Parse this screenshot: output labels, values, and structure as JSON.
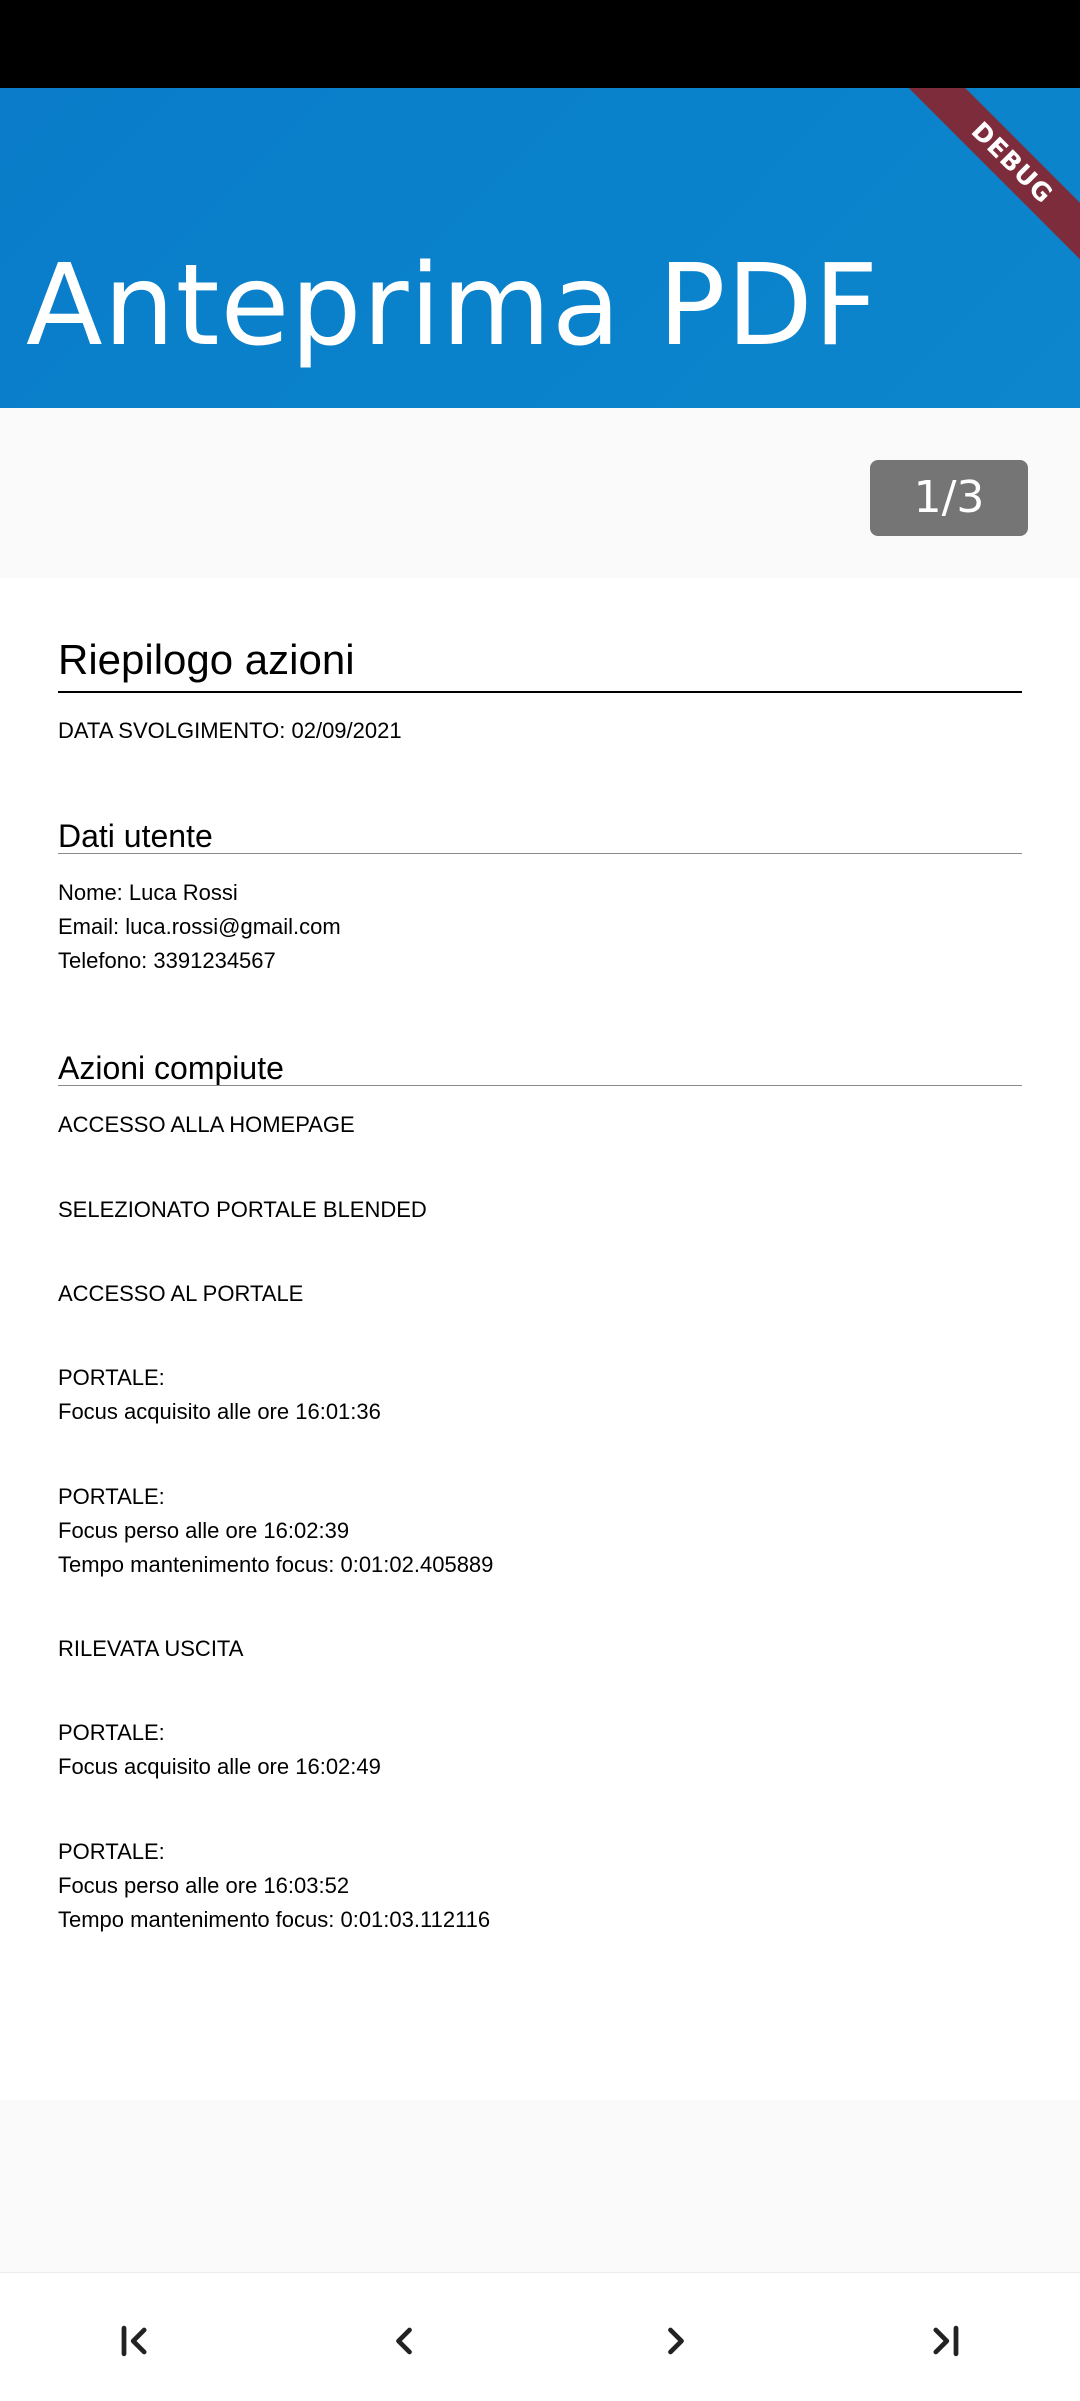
{
  "app_bar": {
    "title": "Anteprima PDF",
    "debug_label": "DEBUG"
  },
  "pager": {
    "indicator": "1/3"
  },
  "document": {
    "title": "Riepilogo azioni",
    "date_line": "DATA SVOLGIMENTO: 02/09/2021",
    "user_section": {
      "heading": "Dati utente",
      "name": "Nome: Luca Rossi",
      "email": "Email: luca.rossi@gmail.com",
      "phone": "Telefono: 3391234567"
    },
    "actions_section": {
      "heading": "Azioni compiute",
      "lines": [
        "ACCESSO ALLA HOMEPAGE",
        "SELEZIONATO PORTALE BLENDED",
        "ACCESSO AL PORTALE",
        "PORTALE:",
        "Focus acquisito alle ore 16:01:36",
        "PORTALE:",
        "Focus perso alle ore 16:02:39",
        "Tempo mantenimento focus: 0:01:02.405889",
        "RILEVATA USCITA",
        "PORTALE:",
        "Focus acquisito alle ore 16:02:49",
        "PORTALE:",
        "Focus perso alle ore 16:03:52",
        "Tempo mantenimento focus: 0:01:03.112116"
      ]
    }
  },
  "nav": {
    "first": "first-page-icon",
    "prev": "previous-page-icon",
    "next": "next-page-icon",
    "last": "last-page-icon"
  }
}
